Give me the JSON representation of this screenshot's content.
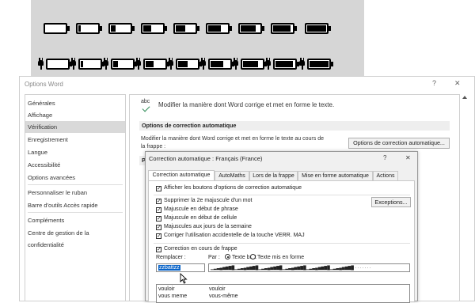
{
  "batteries": {
    "row1_levels": [
      0.0,
      0.12,
      0.25,
      0.4,
      0.5,
      0.65,
      0.78,
      0.9,
      1.0
    ],
    "row2_levels": [
      0.0,
      0.12,
      0.25,
      0.4,
      0.5,
      0.65,
      0.78,
      0.9,
      1.0
    ]
  },
  "options_window": {
    "title": "Options Word",
    "help_glyph": "?",
    "close_glyph": "✕",
    "nav": [
      {
        "label": "Générales",
        "active": false
      },
      {
        "label": "Affichage",
        "active": false
      },
      {
        "label": "Vérification",
        "active": true
      },
      {
        "label": "Enregistrement",
        "active": false
      },
      {
        "label": "Langue",
        "active": false
      },
      {
        "label": "Accessibilité",
        "active": false
      },
      {
        "label": "Options avancées",
        "active": false
      },
      {
        "label": "Personnaliser le ruban",
        "active": false
      },
      {
        "label": "Barre d'outils Accès rapide",
        "active": false
      },
      {
        "label": "Compléments",
        "active": false
      },
      {
        "label": "Centre de gestion de la confidentialité",
        "active": false
      }
    ],
    "main": {
      "icon_text": "abc",
      "intro": "Modifier la manière dont Word corrige et met en forme le texte.",
      "section_autocorrect": "Options de correction automatique",
      "autocorrect_desc_1": "Modifier la manière dont Word corrige et met en forme le texte au cours de",
      "autocorrect_desc_2": "la frappe :",
      "autocorrect_button": "Options de correction automatique...",
      "section_partial": "P"
    }
  },
  "dialog": {
    "title": "Correction automatique : Français (France)",
    "help_glyph": "?",
    "close_glyph": "✕",
    "tabs": [
      {
        "label": "Correction automatique",
        "active": true
      },
      {
        "label": "AutoMaths",
        "active": false
      },
      {
        "label": "Lors de la frappe",
        "active": false
      },
      {
        "label": "Mise en forme automatique",
        "active": false
      },
      {
        "label": "Actions",
        "active": false
      }
    ],
    "show_buttons": "Afficher les boutons d'options de correction automatique",
    "options": [
      "Supprimer la 2e majuscule d'un mot",
      "Majuscule en début de phrase",
      "Majuscule en début de cellule",
      "Majuscules aux jours de la semaine",
      "Corriger l'utilisation accidentelle de la touche VERR. MAJ"
    ],
    "exceptions_button": "Exceptions...",
    "replace_while_typing": "Correction en cours de frappe",
    "replace_label": "Remplacer :",
    "with_label": "Par :",
    "radio_plain": "Texte brut",
    "radio_formatted": "Texte mis en forme",
    "replace_value": "zzbattzz",
    "with_value": "▁▂▃▄▅▆▇█▁▂▃▄▅▆▇█▁▂▃▄▅▆▇█▁▂▃▄▅▆▇█▁▂▃▄▅▆▇█▁▂▃▄▅▆▇█ · · · · · · ·",
    "list": [
      {
        "from": "vouloir",
        "to": "vouloir"
      },
      {
        "from": "vous meme",
        "to": "vous-même"
      }
    ]
  }
}
